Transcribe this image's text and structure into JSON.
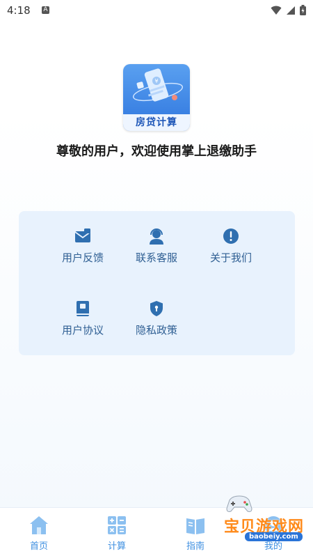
{
  "status_bar": {
    "time": "4:18",
    "notification_letter": "A",
    "icons": [
      "wifi-icon",
      "signal-icon",
      "battery-icon"
    ]
  },
  "app": {
    "logo_label": "房贷计算",
    "welcome_text": "尊敬的用户，欢迎使用掌上退缴助手"
  },
  "menu": {
    "items": [
      {
        "label": "用户反馈",
        "icon": "feedback-envelope-icon"
      },
      {
        "label": "联系客服",
        "icon": "customer-service-headset-icon"
      },
      {
        "label": "关于我们",
        "icon": "info-exclamation-icon"
      },
      {
        "label": "用户协议",
        "icon": "agreement-book-icon"
      },
      {
        "label": "隐私政策",
        "icon": "privacy-shield-icon"
      }
    ]
  },
  "bottom_nav": {
    "items": [
      {
        "label": "首页",
        "icon": "home-icon"
      },
      {
        "label": "计算",
        "icon": "calculator-icon"
      },
      {
        "label": "指南",
        "icon": "guide-book-icon"
      },
      {
        "label": "我的",
        "icon": "profile-icon"
      }
    ]
  },
  "watermark": {
    "text": "宝贝游戏网",
    "url": "baobeiy.com"
  },
  "colors": {
    "accent": "#3e8fe0",
    "icon_blue": "#2f6fb0",
    "card_bg": "#e8f2fd",
    "watermark_orange": "#ff8a1a"
  }
}
